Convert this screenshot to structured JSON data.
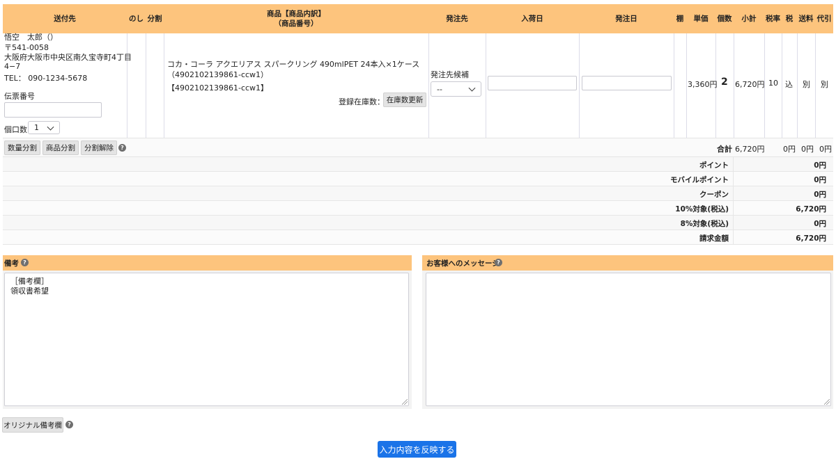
{
  "table": {
    "headers": {
      "destination": "送付先",
      "noshi": "のし",
      "split": "分割",
      "product_line1": "商品【商品内訳】",
      "product_line2": "（商品番号）",
      "supplier": "発注先",
      "arrival_date": "入荷日",
      "order_date": "発注日",
      "shelf": "棚",
      "unit_price": "単価",
      "quantity": "個数",
      "subtotal": "小計",
      "tax_rate": "税率",
      "tax": "税",
      "shipping": "送料",
      "cod": "代引"
    },
    "row": {
      "name": "悟空　太郎（）",
      "postal": "〒541-0058",
      "address_line1": "大阪府大阪市中央区南久宝寺町4丁目",
      "address_line2": "4−7",
      "tel": "TEL： 090-1234-5678",
      "slip_label": "伝票番号",
      "slip_value": "",
      "parcels_label": "個口数",
      "parcels_value": "1",
      "product_name": "コカ・コーラ アクエリアス スパークリング 490mlPET 24本入×1ケース",
      "product_breakdown": "（4902102139861-ccw1）",
      "product_code": "【4902102139861-ccw1】",
      "stock_label": "登録在庫数：-",
      "stock_update_button": "在庫数更新",
      "supplier_candidate_label": "発注先候補",
      "supplier_select_value": "--",
      "arrival_date_value": "",
      "order_date_value": "",
      "unit_price": "3,360円",
      "quantity": "2",
      "subtotal": "6,720円",
      "tax_rate": "10",
      "tax": "込",
      "shipping": "別",
      "cod": "別"
    },
    "actions": {
      "quantity_split": "数量分割",
      "product_split": "商品分割",
      "cancel_split": "分割解除"
    },
    "total": {
      "label": "合計",
      "subtotal": "6,720円",
      "tax": "0円",
      "shipping": "0円",
      "cod": "0円"
    }
  },
  "summary": [
    {
      "label": "ポイント",
      "value": "0円"
    },
    {
      "label": "モバイルポイント",
      "value": "0円"
    },
    {
      "label": "クーポン",
      "value": "0円"
    },
    {
      "label": "10%対象(税込)",
      "value": "6,720円"
    },
    {
      "label": "8%対象(税込)",
      "value": "0円"
    },
    {
      "label": "請求金額",
      "value": "6,720円"
    }
  ],
  "remarks": {
    "title": "備考",
    "text": "［備考欄］\n領収書希望"
  },
  "customer_message": {
    "title": "お客様へのメッセージ",
    "text": ""
  },
  "original_remarks_button": "オリジナル備考欄",
  "apply_button": "入力内容を反映する",
  "colors": {
    "header_bg": "#fdc47d",
    "primary_button": "#1a73e8"
  },
  "icons": {
    "help": "question-circle-icon",
    "dropdown": "chevron-down-icon",
    "resize": "resize-grip-icon"
  }
}
